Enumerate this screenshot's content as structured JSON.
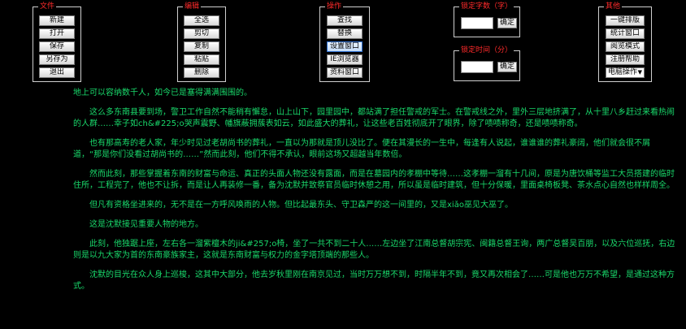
{
  "panels": {
    "file": {
      "title": "文件",
      "buttons": [
        "新建",
        "打开",
        "保存",
        "另存为",
        "退出"
      ]
    },
    "edit": {
      "title": "编辑",
      "buttons": [
        "全选",
        "剪切",
        "复制",
        "粘贴",
        "删除"
      ]
    },
    "ops": {
      "title": "操作",
      "buttons": [
        "查找",
        "替换",
        "设置窗口",
        "IE浏览器",
        "资料窗口"
      ]
    },
    "lock_chars": {
      "title": "锁定字数（字）",
      "confirm": "确定",
      "value": ""
    },
    "lock_time": {
      "title": "锁定时间（分）",
      "confirm": "确定",
      "value": ""
    },
    "other": {
      "title": "其他",
      "buttons": [
        "一键排版",
        "统计窗口",
        "阅览模式",
        "注册帮助"
      ],
      "select": "电脑操作"
    }
  },
  "content": {
    "paragraphs": [
      "地上可以容纳数千人，如今已是塞得满满围围的。",
      "这么多东南县要到场，警卫工作自然不能稍有懈怠，山上山下，园里园中，都站满了担任警戒的军士。在警戒线之外，里外三层地挤满了，从十里八乡赶过来看热闹的人群……幸子如ch&#225;o哭声震野、幡旗蔽拥蔟表如云，如此盛大的葬礼，让这些老百姓彻底开了眼界，除了啧啧称奇，还是啧啧称奇。",
      "也有那高寿的老人家，年少时见过老胡尚书的葬礼，一直以为那就是顶儿没比了。便在其漫长的一生中，每逢有人说起，谁谁谁的葬礼豪阔，他们就会很不屑道，“那是你们没看过胡尚书的……”然而此刻，他们不得不承认，眼前这场又超越当年数倍。",
      "然而此刻，那些掌握着东南的财富与命运、真正的头面人物还没有露面，而是在墓园内的孝棚中等待……这孝棚一溜有十几间，原是为唐饮桶等监工大员搭建的临时住所，工程完了，他也不让拆，而是让人再装修一番，备为沈默并致祭官员临时休憩之用，所以虽是临时建筑，但十分保暖，里面桌椅板凳、茶水点心自然也样样周全。",
      "但凡有资格坐进来的，无不是在一方呼风唤雨的人物。但比起最东头、守卫森严的这一间里的，又是xiǎo巫见大巫了。",
      "这是沈默接见重要人物的地方。",
      "此刻，他独踞上座，左右各一溜紫檀木的ji&#257;o椅，坐了一共不到二十人……左边坐了江南总督胡宗宪、闽籍总督王询，两广总督吴百朋，以及六位巡抚，右边则是以九大家为首的东南豪族家主，这就是东南财富与权力的金字塔顶端的那些人。",
      "沈默的目光在众人身上巡梭，这其中大部分，他去岁秋里刚在南京见过，当时万万想不到，时隔半年不到，竟又再次相会了……可是他也万万不希望，是通过这种方式。"
    ]
  },
  "colors": {
    "background": "#000000",
    "text": "#19d96b",
    "panel_title": "#ff2a2a",
    "panel_border": "#cfcfcf"
  }
}
